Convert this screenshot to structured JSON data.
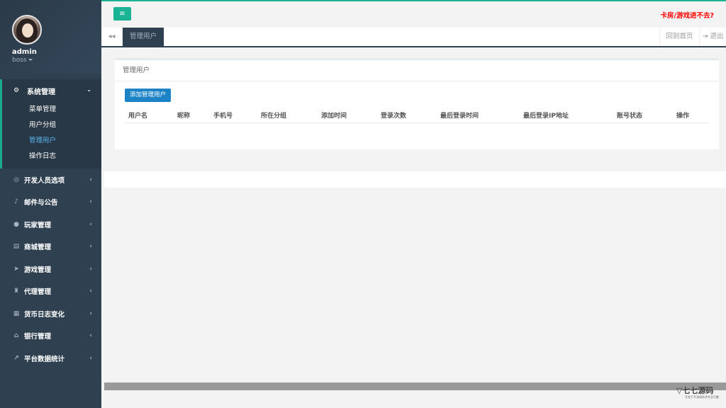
{
  "profile": {
    "name": "admin",
    "role": "boss"
  },
  "menu_open": {
    "label": "系统管理",
    "icon": "cogs-icon",
    "children": [
      {
        "label": "菜单管理",
        "active": false
      },
      {
        "label": "用户分组",
        "active": false
      },
      {
        "label": "管理用户",
        "active": true
      },
      {
        "label": "操作日志",
        "active": false
      }
    ]
  },
  "menu": [
    {
      "label": "开发人员选项",
      "icon": "gamepad-icon"
    },
    {
      "label": "邮件与公告",
      "icon": "bell-icon"
    },
    {
      "label": "玩家管理",
      "icon": "user-icon"
    },
    {
      "label": "商城管理",
      "icon": "cart-icon"
    },
    {
      "label": "游戏管理",
      "icon": "rocket-icon"
    },
    {
      "label": "代理管理",
      "icon": "user-secret-icon"
    },
    {
      "label": "货币日志变化",
      "icon": "calendar-icon"
    },
    {
      "label": "银行管理",
      "icon": "bank-icon"
    },
    {
      "label": "平台数据统计",
      "icon": "line-chart-icon"
    }
  ],
  "navbar": {
    "toggle_icon": "bars-icon",
    "alert_text": "卡房/游戏进不去?"
  },
  "tabs": {
    "active": "管理用户",
    "home": "回到首页",
    "logout": "退出"
  },
  "panel": {
    "title": "管理用户",
    "add_button": "添加管理用户",
    "columns": [
      "用户名",
      "昵称",
      "手机号",
      "所在分组",
      "添加时间",
      "登录次数",
      "最后登录时间",
      "最后登录IP地址",
      "账号状态",
      "操作"
    ]
  },
  "watermark": {
    "text": "七七源码",
    "subtext": "开发千手游戏技术专业可靠"
  },
  "colors": {
    "accent": "#1ab394",
    "sidebar": "#2f4050",
    "primary_button": "#1c84c6",
    "alert": "#ff0000"
  }
}
